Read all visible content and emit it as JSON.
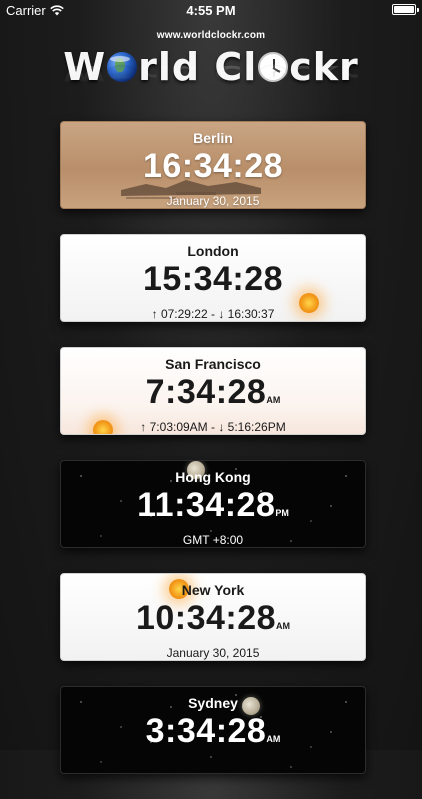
{
  "status_bar": {
    "carrier": "Carrier",
    "time": "4:55 PM"
  },
  "header": {
    "site_url": "www.worldclockr.com",
    "logo_left": "W",
    "logo_mid": "rld Cl",
    "logo_right": "ckr"
  },
  "clocks": [
    {
      "city": "Berlin",
      "time": "16:34:28",
      "ampm": "",
      "detail": "January 30, 2015",
      "theme": "photo"
    },
    {
      "city": "London",
      "time": "15:34:28",
      "ampm": "",
      "detail": "↑  07:29:22 - ↓  16:30:37",
      "theme": "day"
    },
    {
      "city": "San Francisco",
      "time": "7:34:28",
      "ampm": "AM",
      "detail": "↑  7:03:09AM - ↓  5:16:26PM",
      "theme": "day"
    },
    {
      "city": "Hong Kong",
      "time": "11:34:28",
      "ampm": "PM",
      "detail": "GMT +8:00",
      "theme": "night"
    },
    {
      "city": "New York",
      "time": "10:34:28",
      "ampm": "AM",
      "detail": "January 30, 2015",
      "theme": "day"
    },
    {
      "city": "Sydney",
      "time": "3:34:28",
      "ampm": "AM",
      "detail": "",
      "theme": "night"
    }
  ],
  "icons": {
    "wifi": "wifi-icon",
    "battery": "battery-icon",
    "earth": "earth-icon",
    "clock": "clock-icon",
    "sun": "sun-icon",
    "moon": "moon-icon"
  }
}
